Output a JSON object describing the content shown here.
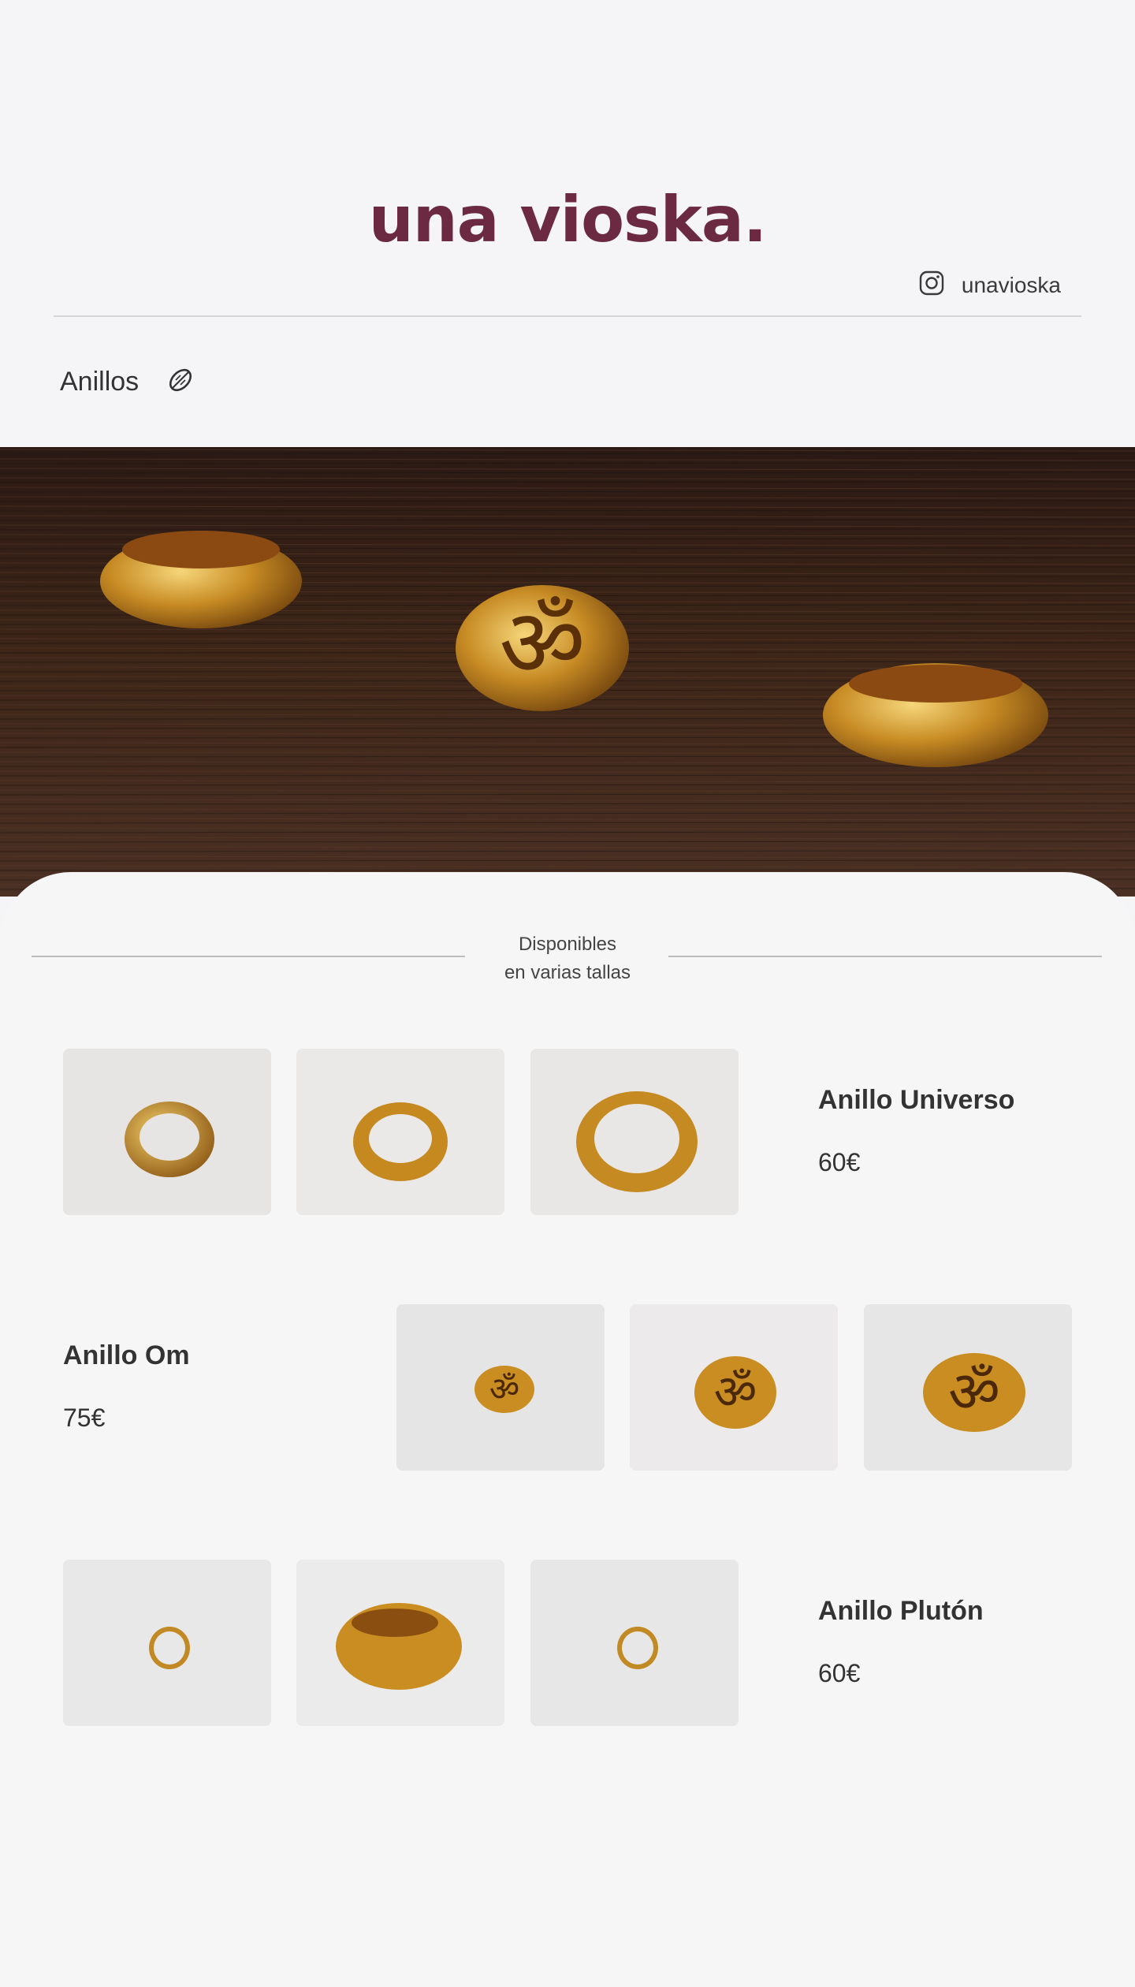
{
  "header": {
    "logo": "una vioska.",
    "instagram_handle": "unavioska",
    "accent_color": "#6b2a42"
  },
  "nav": {
    "category_label": "Anillos",
    "category_icon": "ring-leaf-icon"
  },
  "hero": {
    "image": "three gold rings on a dark wooden table"
  },
  "availability": {
    "line1": "Disponibles",
    "line2": "en varias tallas"
  },
  "products": [
    {
      "name": "Anillo Universo",
      "price": "60€"
    },
    {
      "name": "Anillo Om",
      "price": "75€"
    },
    {
      "name": "Anillo Plutón",
      "price": "60€"
    }
  ]
}
